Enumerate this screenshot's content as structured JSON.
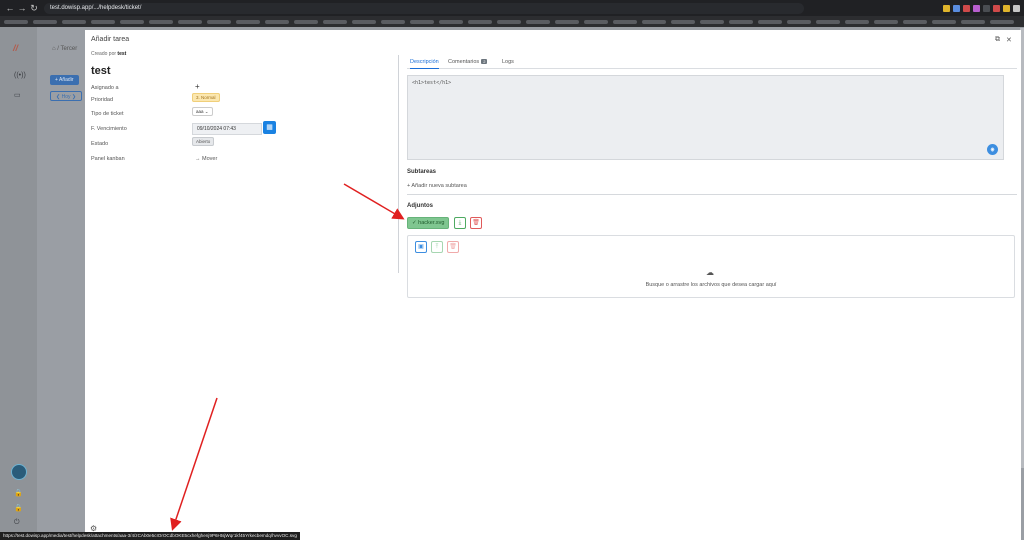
{
  "browser": {
    "back": "←",
    "forward": "→",
    "reload": "↻",
    "url": "test.dowisp.app/.../helpdesk/ticket/"
  },
  "background": {
    "logo": "//",
    "breadcrumb": "⌂ / Tercer",
    "add_button": "+ Añadir",
    "back_button": "❮ Hoy ❯"
  },
  "modal": {
    "title": "Añadir tarea",
    "created_by_prefix": "Creado por",
    "created_by_user": "test",
    "task_name": "test",
    "fields": {
      "assigned_label": "Asignado a",
      "assigned_value": "+",
      "priority_label": "Prioridad",
      "priority_value": "3. Normal",
      "ticket_type_label": "Tipo de ticket",
      "ticket_type_value": "aaa",
      "due_label": "F. Vencimiento",
      "due_value": "09/10/2024 07:43",
      "state_label": "Estado",
      "state_value": "Abierto",
      "kanban_label": "Panel kanban",
      "kanban_value": "→ Mover"
    }
  },
  "tabs": [
    {
      "label": "Descripción"
    },
    {
      "label": "Comentarios",
      "count": "2"
    },
    {
      "label": "Logs"
    }
  ],
  "description": {
    "content": "<h1>test</h1>"
  },
  "subtasks": {
    "title": "Subtareas",
    "add_label": "+ Añadir nueva subtarea"
  },
  "attachments": {
    "title": "Adjuntos",
    "file_name": "✓ hacker.svg",
    "upload_text": "Busque o arrastre los archivos que desea cargar aquí"
  },
  "statusbar": {
    "url": "https://test.dowisp.app/media/test/helpdesk/attachments/aaa-3/4/zCAb0e5cIOrOCdbOKE5cxhefghenj9P6HtsjWqr1kf45Yrkecbemdq/hvvvOC.svg"
  },
  "colors": {
    "primary": "#1a82e2",
    "success": "#7fc690",
    "danger": "#e05a5a",
    "warning_bg": "#fbe7b0",
    "annotation": "#e02020"
  }
}
